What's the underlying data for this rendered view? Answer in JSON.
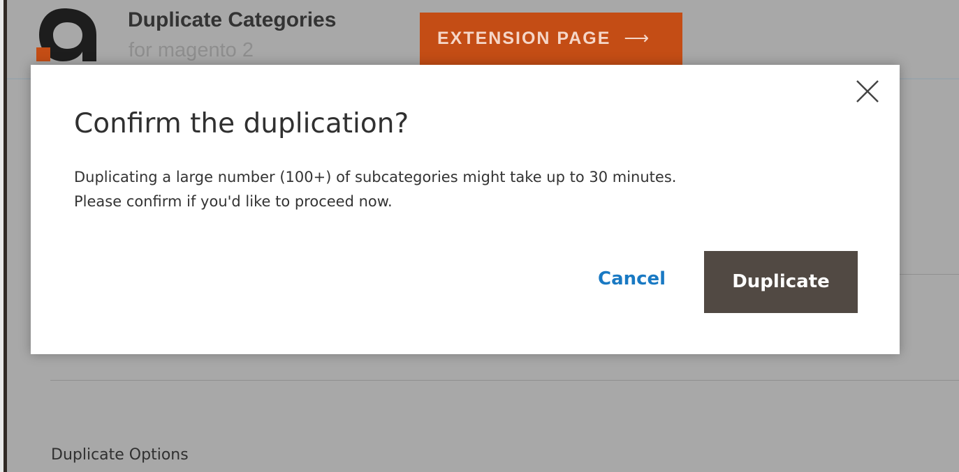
{
  "header": {
    "product_title": "Duplicate Categories",
    "product_subtitle": "for magento 2",
    "extension_button_label": "EXTENSION PAGE",
    "extension_button_arrow": "⟶",
    "brand_color": "#c44d15"
  },
  "background": {
    "section_title": "Duplicate Options"
  },
  "modal": {
    "title": "Confirm the duplication?",
    "message_line_1": "Duplicating a large number (100+) of subcategories might take up to 30 minutes.",
    "message_line_2": "Please confirm if you'd like to proceed now.",
    "cancel_label": "Cancel",
    "confirm_label": "Duplicate",
    "close_icon": "close-icon",
    "confirm_color": "#514943",
    "cancel_color": "#1979c3"
  }
}
